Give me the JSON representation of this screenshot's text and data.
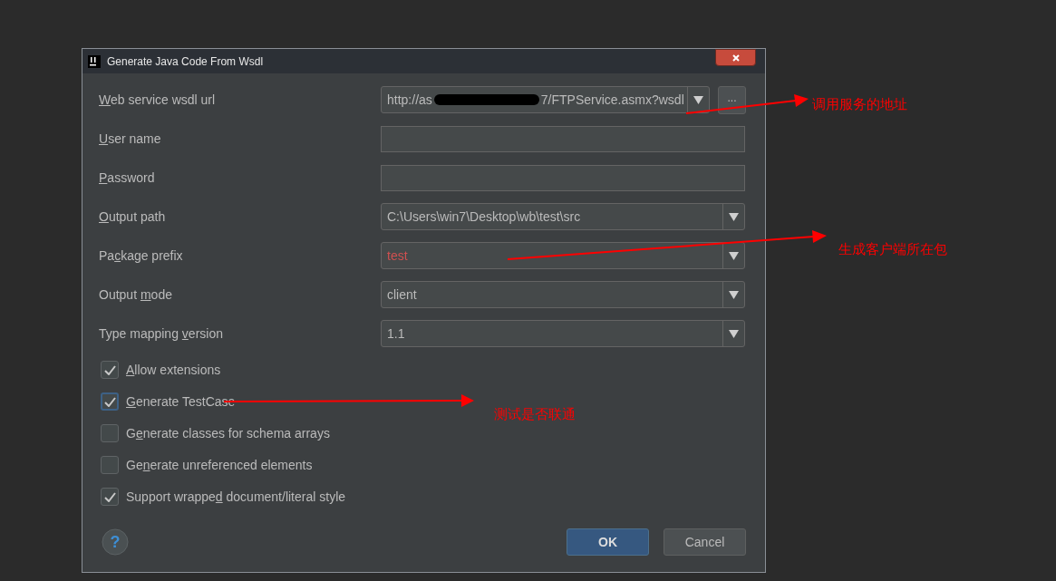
{
  "dialog": {
    "title": "Generate Java Code From Wsdl"
  },
  "fields": [
    {
      "kind": "combo-browse",
      "label": {
        "key": "W",
        "post": "eb service wsdl url"
      },
      "value_start": "http://as",
      "redacted": true,
      "value_end": "7/FTPService.asmx?wsdl",
      "browse": "..."
    },
    {
      "kind": "text",
      "label": {
        "key": "U",
        "post": "ser name"
      }
    },
    {
      "kind": "text",
      "label": {
        "key": "P",
        "post": "assword"
      }
    },
    {
      "kind": "combo",
      "label": {
        "key": "O",
        "post": "utput path"
      },
      "value_start": "C:\\Users\\win7\\Desktop\\wb\\test\\src",
      "error": false
    },
    {
      "kind": "combo",
      "label": {
        "pre": "Pa",
        "key": "c",
        "post": "kage prefix"
      },
      "value_start": "test",
      "error": true
    },
    {
      "kind": "combo",
      "label": {
        "pre": "Output ",
        "key": "m",
        "post": "ode"
      },
      "value_start": "client",
      "error": false
    },
    {
      "kind": "combo",
      "label": {
        "pre": "Type mapping ",
        "key": "v",
        "post": "ersion"
      },
      "value_start": "1.1",
      "error": false
    }
  ],
  "options": [
    {
      "label": {
        "key": "A",
        "post": "llow extensions"
      },
      "checked": true,
      "focused": false
    },
    {
      "label": {
        "key": "G",
        "post": "enerate TestCase"
      },
      "checked": true,
      "focused": true
    },
    {
      "label": {
        "pre": "G",
        "key": "e",
        "post": "nerate classes for schema arrays"
      },
      "checked": false,
      "focused": false
    },
    {
      "label": {
        "pre": "Ge",
        "key": "n",
        "post": "erate unreferenced elements"
      },
      "checked": false,
      "focused": false
    },
    {
      "label": {
        "pre": "Support wrappe",
        "key": "d",
        "post": " document/literal style"
      },
      "checked": true,
      "focused": false
    }
  ],
  "help": "?",
  "buttons": [
    {
      "label": "OK",
      "primary": true
    },
    {
      "label": "Cancel",
      "primary": false
    }
  ],
  "annotations": [
    "调用服务的地址",
    "生成客户端所在包",
    "测试是否联通"
  ]
}
